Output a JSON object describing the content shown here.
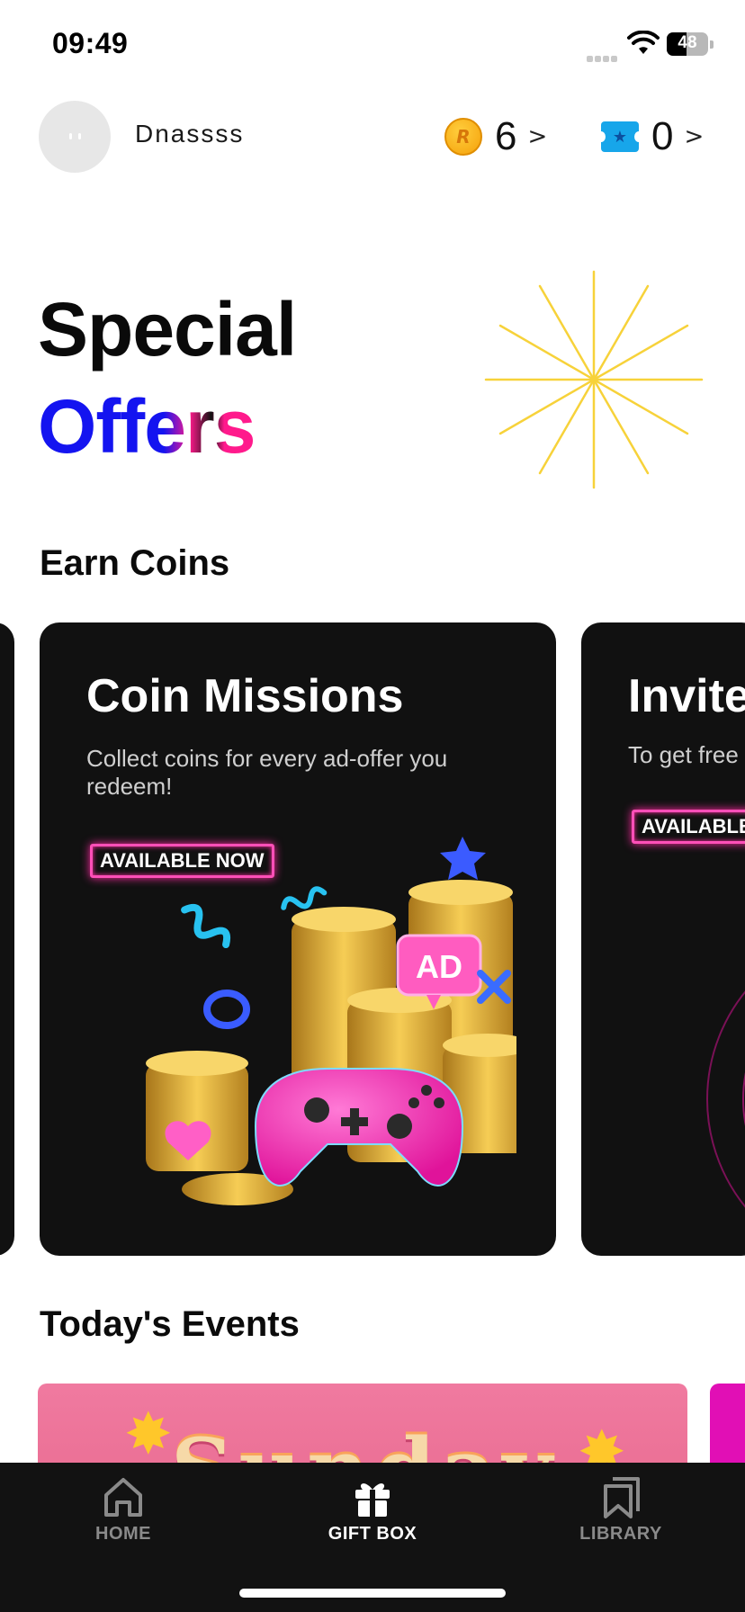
{
  "status_bar": {
    "time": "09:49",
    "battery": "48",
    "battery_level": 0.48
  },
  "header": {
    "username": "Dnassss",
    "coins": "6",
    "tickets": "0",
    "chevron": ">"
  },
  "hero": {
    "line1": "Special",
    "line2": "Offers"
  },
  "earn_coins": {
    "title": "Earn Coins",
    "cards": [
      {
        "title": "Coin Missions",
        "description": "Collect coins for every ad-offer you redeem!",
        "badge": "AVAILABLE NOW",
        "illustration_label": "AD"
      },
      {
        "title": "Invite",
        "description": "To get free",
        "badge": "AVAILABLE"
      }
    ]
  },
  "events": {
    "title": "Today's Events",
    "banner_text": "Sunday"
  },
  "bottom_nav": {
    "items": [
      {
        "label": "HOME",
        "icon": "home-icon",
        "active": false
      },
      {
        "label": "GIFT BOX",
        "icon": "gift-icon",
        "active": true
      },
      {
        "label": "LIBRARY",
        "icon": "bookmark-icon",
        "active": false
      }
    ]
  },
  "colors": {
    "offers_blue": "#1414f0",
    "offers_pink": "#ff1a8c",
    "burst_yellow": "#f7d23a",
    "card_bg": "#111111",
    "badge_neon": "#ff4fb8",
    "nav_bg": "#121212"
  }
}
